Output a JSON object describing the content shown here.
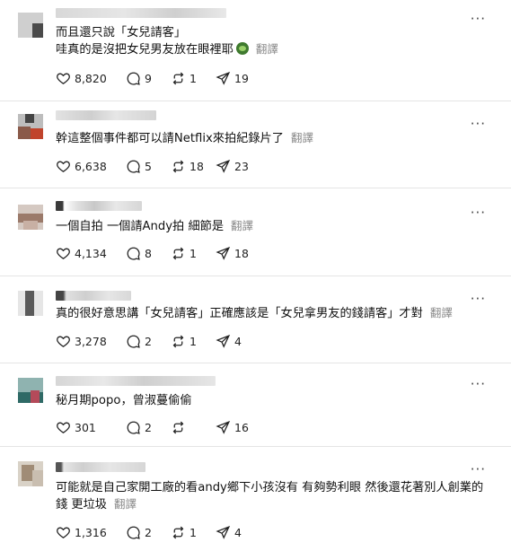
{
  "icons": {
    "more": "more-icon",
    "like": "heart-icon",
    "reply": "comment-icon",
    "repost": "repost-icon",
    "share": "send-icon"
  },
  "posts": [
    {
      "more": "···",
      "lines": [
        "而且還只說「女兒請客」",
        "哇真的是沒把女兒男友放在眼裡耶"
      ],
      "translate": "翻譯",
      "likes": "8,820",
      "replies": "9",
      "reposts": "1",
      "shares": "19"
    },
    {
      "more": "···",
      "lines": [
        "幹這整個事件都可以請Netflix來拍紀錄片了"
      ],
      "translate": "翻譯",
      "likes": "6,638",
      "replies": "5",
      "reposts": "18",
      "shares": "23"
    },
    {
      "more": "···",
      "lines": [
        "一個自拍 一個請Andy拍 細節是"
      ],
      "translate": "翻譯",
      "likes": "4,134",
      "replies": "8",
      "reposts": "1",
      "shares": "18"
    },
    {
      "more": "···",
      "lines": [
        "真的很好意思講「女兒請客」正確應該是「女兒拿男友的錢請客」才對"
      ],
      "translate": "翻譯",
      "likes": "3,278",
      "replies": "2",
      "reposts": "1",
      "shares": "4"
    },
    {
      "more": "···",
      "lines": [
        "秘月期popo，曾淑蔓偷偷"
      ],
      "translate": "",
      "likes": "301",
      "replies": "2",
      "reposts": "",
      "shares": "16"
    },
    {
      "more": "···",
      "lines": [
        "可能就是自己家開工廠的看andy鄉下小孩沒有 有夠勢利眼 然後還花著別人創業的",
        "錢 更垃圾"
      ],
      "translate": "翻譯",
      "likes": "1,316",
      "replies": "2",
      "reposts": "1",
      "shares": "4"
    }
  ]
}
